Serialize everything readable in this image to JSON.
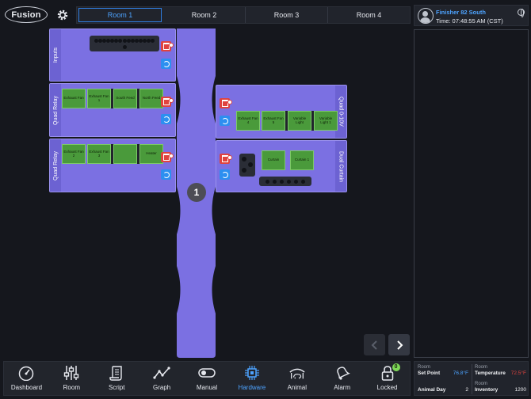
{
  "logo": "Fusion",
  "tabs": [
    "Room 1",
    "Room 2",
    "Room 3",
    "Room 4"
  ],
  "user": {
    "name": "Finisher 82 South",
    "time": "Time: 07:48:55 AM (CST)"
  },
  "cards": {
    "inputs": {
      "title": "Inputs"
    },
    "relay1": {
      "title": "Quad Relay",
      "items": [
        "Exhaust Fan",
        "Exhaust Fan 1",
        "South Feed",
        "North Feed"
      ]
    },
    "relay2": {
      "title": "Quad Relay",
      "items": [
        "Exhaust Fan 2",
        "Exhaust Fan 3",
        "",
        "Heater"
      ]
    },
    "quad010v": {
      "title": "Quad 0-10V",
      "items": [
        "Exhaust Fan 4",
        "Exhaust Fan 5",
        "Variable Light",
        "Variable Light 1"
      ]
    },
    "curtain": {
      "title": "Dual Curtain",
      "items": [
        "Curtain",
        "Curtain 1"
      ]
    }
  },
  "bus_number": "1",
  "bottom_nav": [
    {
      "label": "Dashboard",
      "icon": "dashboard-gauge-icon"
    },
    {
      "label": "Room",
      "icon": "room-sliders-icon"
    },
    {
      "label": "Script",
      "icon": "script-scroll-icon"
    },
    {
      "label": "Graph",
      "icon": "graph-line-icon"
    },
    {
      "label": "Manual",
      "icon": "manual-toggle-icon"
    },
    {
      "label": "Hardware",
      "icon": "hardware-chip-icon",
      "active": true
    },
    {
      "label": "Animal",
      "icon": "animal-barn-icon"
    },
    {
      "label": "Alarm",
      "icon": "alarm-bell-icon"
    },
    {
      "label": "Locked",
      "icon": "lock-icon",
      "badge": "0"
    }
  ],
  "stats": {
    "left": {
      "small": "Room",
      "label": "Set Point",
      "value": "76.8°F",
      "row2_label": "Animal Day",
      "row2_value": "2"
    },
    "right": {
      "small": "Room",
      "label": "Temperature",
      "value": "72.5°F",
      "small2": "Room",
      "row2_label": "Inventory",
      "row2_value": "1200"
    }
  },
  "colors": {
    "accent": "#4da3ff",
    "card": "#7b70e2",
    "relay": "#4a9a3b",
    "danger": "#e0433f",
    "setpoint": "#4da3ff",
    "temperature": "#e0433f"
  }
}
